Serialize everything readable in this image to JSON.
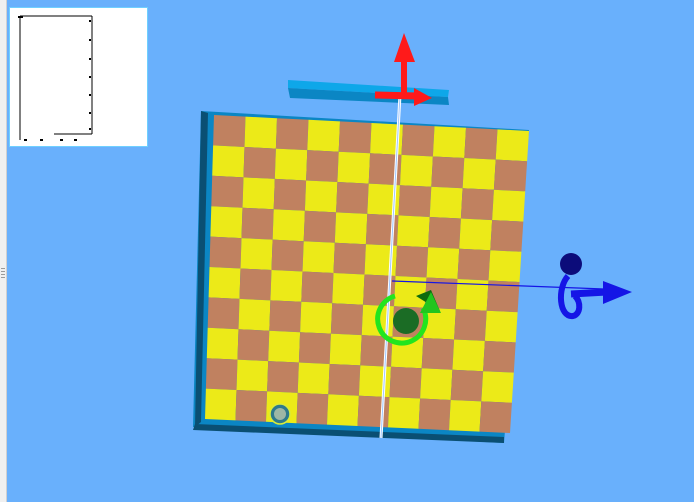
{
  "colors": {
    "viewport_background": "#69b0fc",
    "board_light": "#ecea18",
    "board_dark": "#c08160",
    "board_frame": "#0b86c4",
    "board_frame_dark": "#0a4f73",
    "rail_top": "#0ea7e9",
    "gizmo_x_axis": "#ff1a1a",
    "gizmo_y_axis": "#1515e6",
    "gizmo_rotate": "#22e51e",
    "gizmo_center": "#1b6c25",
    "gizmo_sphere": "#0c0c7a",
    "inset_background": "#ffffff",
    "inset_border": "#6fd0ff"
  },
  "board": {
    "rows": 10,
    "columns": 10
  },
  "icons": {
    "ball": "ball-icon",
    "move_x": "arrow-up-icon",
    "move_y": "arrow-right-icon",
    "rotate": "rotate-arrow-icon",
    "grip": "splitter-grip-icon"
  }
}
